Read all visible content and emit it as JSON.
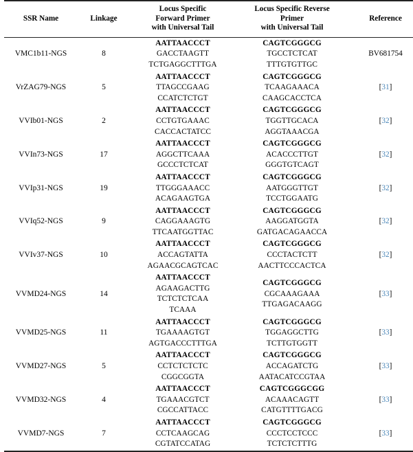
{
  "table": {
    "columns": [
      {
        "key": "ssr_name",
        "lines": [
          "SSR Name"
        ]
      },
      {
        "key": "linkage",
        "lines": [
          "Linkage"
        ]
      },
      {
        "key": "forward",
        "lines": [
          "Locus Specific",
          "Forward Primer",
          "with Universal Tail"
        ]
      },
      {
        "key": "reverse",
        "lines": [
          "Locus Specific Reverse",
          "Primer",
          "with Universal Tail"
        ]
      },
      {
        "key": "reference",
        "lines": [
          "Reference"
        ]
      }
    ],
    "link_color": "#4a86b8",
    "rows": [
      {
        "ssr_name": "VMC1b11-NGS",
        "linkage": "8",
        "forward_tail": "AATTAACCCT",
        "forward_lines": [
          "GACCTAAGTT",
          "TCTGAGGCTTTGA"
        ],
        "reverse_tail": "CAGTCGGGCG",
        "reverse_lines": [
          "TGCCTCTCAT",
          "TTTGTGTTGC"
        ],
        "reference": "BV681754",
        "reference_is_link": false
      },
      {
        "ssr_name": "VrZAG79-NGS",
        "linkage": "5",
        "forward_tail": "AATTAACCCT",
        "forward_lines": [
          "TTAGCCGAAG",
          "CCATCTCTGT"
        ],
        "reverse_tail": "CAGTCGGGCG",
        "reverse_lines": [
          "TCAAGAAACA",
          "CAAGCACCTCA"
        ],
        "reference": "31",
        "reference_is_link": true
      },
      {
        "ssr_name": "VVIb01-NGS",
        "linkage": "2",
        "forward_tail": "AATTAACCCT",
        "forward_lines": [
          "CCTGTGAAAC",
          "CACCACTATCC"
        ],
        "reverse_tail": "CAGTCGGGCG",
        "reverse_lines": [
          "TGGTTGCACA",
          "AGGTAAACGA"
        ],
        "reference": "32",
        "reference_is_link": true
      },
      {
        "ssr_name": "VVIn73-NGS",
        "linkage": "17",
        "forward_tail": "AATTAACCCT",
        "forward_lines": [
          "AGGCTTCAAA",
          "GCCCTCTCAT"
        ],
        "reverse_tail": "CAGTCGGGCG",
        "reverse_lines": [
          "ACACCCTTGT",
          "GGGTGTCAGT"
        ],
        "reference": "32",
        "reference_is_link": true
      },
      {
        "ssr_name": "VVIp31-NGS",
        "linkage": "19",
        "forward_tail": "AATTAACCCT",
        "forward_lines": [
          "TTGGGAAACC",
          "ACAGAAGTGA"
        ],
        "reverse_tail": "CAGTCGGGCG",
        "reverse_lines": [
          "AATGGGTTGT",
          "TCCTGGAATG"
        ],
        "reference": "32",
        "reference_is_link": true
      },
      {
        "ssr_name": "VVIq52-NGS",
        "linkage": "9",
        "forward_tail": "AATTAACCCT",
        "forward_lines": [
          "CAGGAAAGTG",
          "TTCAATGGTTAC"
        ],
        "reverse_tail": "CAGTCGGGCG",
        "reverse_lines": [
          "AAGGATGGTA",
          "GATGACAGAACCA"
        ],
        "reference": "32",
        "reference_is_link": true
      },
      {
        "ssr_name": "VVIv37-NGS",
        "linkage": "10",
        "forward_tail": "AATTAACCCT",
        "forward_lines": [
          "ACCAGTATTA",
          "AGAACGCAGTCAC"
        ],
        "reverse_tail": "CAGTCGGGCG",
        "reverse_lines": [
          "CCCTACTCTT",
          "AACTTCCCACTCA"
        ],
        "reference": "32",
        "reference_is_link": true
      },
      {
        "ssr_name": "VVMD24-NGS",
        "linkage": "14",
        "forward_tail": "AATTAACCCT",
        "forward_lines": [
          "AGAAGACTTG",
          "TCTCTCTCAA",
          "TCAAA"
        ],
        "reverse_tail": "CAGTCGGGCG",
        "reverse_lines": [
          "CGCAAAGAAA",
          "TTGAGACAAGG"
        ],
        "reference": "33",
        "reference_is_link": true
      },
      {
        "ssr_name": "VVMD25-NGS",
        "linkage": "11",
        "forward_tail": "AATTAACCCT",
        "forward_lines": [
          "TGAAAAGTGT",
          "AGTGACCCTTTGA"
        ],
        "reverse_tail": "CAGTCGGGCG",
        "reverse_lines": [
          "TGGAGGCTTG",
          "TCTTGTGGTT"
        ],
        "reference": "33",
        "reference_is_link": true
      },
      {
        "ssr_name": "VVMD27-NGS",
        "linkage": "5",
        "forward_tail": "AATTAACCCT",
        "forward_lines": [
          "CCTCTCTCTC",
          "CGGCGGTA"
        ],
        "reverse_tail": "CAGTCGGGCG",
        "reverse_lines": [
          "ACCAGATCTG",
          "AATACATCCGTAA"
        ],
        "reference": "33",
        "reference_is_link": true
      },
      {
        "ssr_name": "VVMD32-NGS",
        "linkage": "4",
        "forward_tail": "AATTAACCCT",
        "forward_lines": [
          "TGAAACGTCT",
          "CGCCATTACC"
        ],
        "reverse_tail": "CAGTCGGGCGG",
        "reverse_lines": [
          "ACAAACAGTT",
          "CATGTTTTGACG"
        ],
        "reference": "33",
        "reference_is_link": true
      },
      {
        "ssr_name": "VVMD7-NGS",
        "linkage": "7",
        "forward_tail": "AATTAACCCT",
        "forward_lines": [
          "CCTCAAGCAG",
          "CGTATCCATAG"
        ],
        "reverse_tail": "CAGTCGGGCG",
        "reverse_lines": [
          "CCCTCCTCCC",
          "TCTCTCTTTG"
        ],
        "reference": "33",
        "reference_is_link": true
      }
    ]
  }
}
